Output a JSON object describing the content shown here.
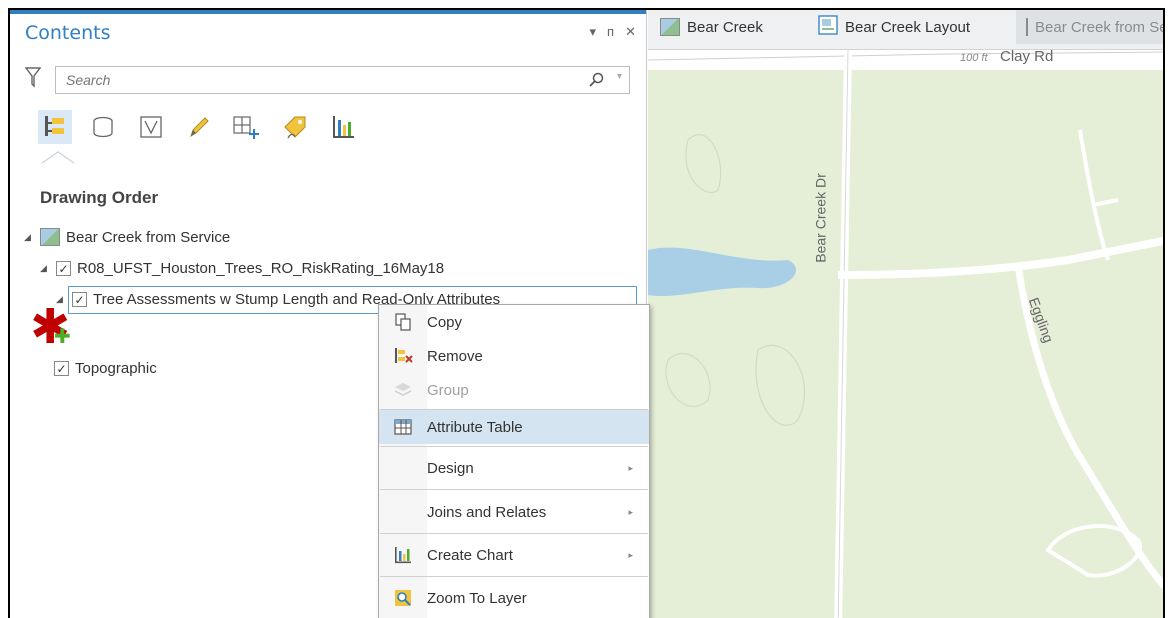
{
  "contents": {
    "title": "Contents",
    "controls": {
      "dropdown": "▾",
      "pin": "ᴨ",
      "close": "✕"
    },
    "search_placeholder": "Search",
    "tools": [
      "list-by-drawing-order-icon",
      "list-by-source-icon",
      "list-by-selection-icon",
      "list-by-editing-icon",
      "list-by-snapping-icon",
      "list-by-labeling-icon",
      "list-by-charts-icon"
    ],
    "section_label": "Drawing Order",
    "tree": {
      "map_name": "Bear Creek from Service",
      "group_layer": "R08_UFST_Houston_Trees_RO_RiskRating_16May18",
      "selected_layer": "Tree Assessments w Stump Length and Read-Only Attributes",
      "basemap": "Topographic"
    }
  },
  "context_menu": {
    "items": [
      {
        "label": "Copy",
        "icon": "copy-icon"
      },
      {
        "label": "Remove",
        "icon": "remove-icon"
      },
      {
        "label": "Group",
        "icon": "group-icon",
        "disabled": true
      },
      {
        "label": "Attribute Table",
        "icon": "table-icon",
        "hovered": true
      },
      {
        "label": "Design",
        "submenu": true
      },
      {
        "label": "Joins and Relates",
        "submenu": true
      },
      {
        "label": "Create Chart",
        "icon": "chart-icon",
        "submenu": true
      },
      {
        "label": "Zoom To Layer",
        "icon": "zoom-to-layer-icon"
      }
    ],
    "arrow": "▸"
  },
  "tabs": [
    {
      "label": "Bear Creek",
      "icon": "map-icon"
    },
    {
      "label": "Bear Creek Layout",
      "icon": "layout-icon"
    },
    {
      "label": "Bear Creek from Service",
      "icon": "map-icon",
      "inactive": true
    }
  ],
  "map": {
    "labels": {
      "clay_rd": "Clay Rd",
      "contour": "100 ft",
      "bear_creek_dr": "Bear Creek Dr",
      "eggling": "Eggling"
    }
  },
  "colors": {
    "accent": "#2f7fc1",
    "map_land": "#e5eed7",
    "map_water": "#a9cfe6",
    "annotation_star": "#c00000",
    "annotation_plus": "#4caf28"
  }
}
